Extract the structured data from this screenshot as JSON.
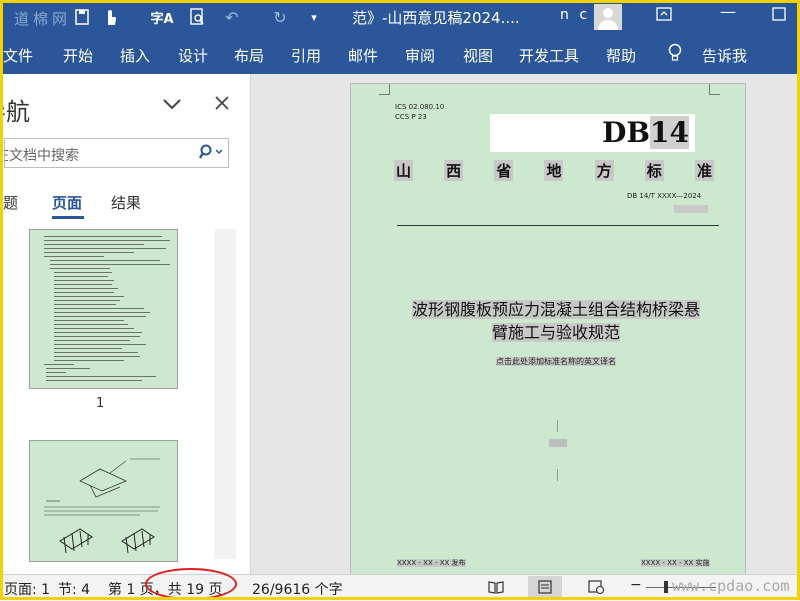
{
  "titlebar": {
    "title": "范》-山西意见稿2024....",
    "user": "n c",
    "icons": [
      "save-icon",
      "touch-mode-icon",
      "spelling-icon",
      "print-preview-icon",
      "undo-icon",
      "redo-icon",
      "customize-icon"
    ]
  },
  "watermark_top": "道棉网",
  "ribbon": {
    "tabs": [
      "文件",
      "开始",
      "插入",
      "设计",
      "布局",
      "引用",
      "邮件",
      "审阅",
      "视图",
      "开发工具",
      "帮助"
    ],
    "tell_me": "告诉我"
  },
  "nav": {
    "title": "导航",
    "search_placeholder": "在文档中搜索",
    "tabs": [
      "标题",
      "页面",
      "结果"
    ],
    "active_tab": "页面",
    "thumb_page_number": "1"
  },
  "document": {
    "ics": "ICS  02.080.10",
    "ccs": "CCS  P 23",
    "db_prefix": "DB",
    "db_number": "14",
    "province": [
      "山",
      "西",
      "省",
      "地",
      "方",
      "标",
      "准"
    ],
    "standard_no": "DB 14/T XXXX—2024",
    "title_line1": "波形钢腹板预应力混凝土组合结构桥梁悬",
    "title_line2": "臂施工与验收规范",
    "english_placeholder": "点击此处添加标准名称的英文译名",
    "issue_date": "XXXX - XX - XX 发布",
    "implement_date": "XXXX - XX - XX 实施"
  },
  "status": {
    "page": "页面: 1",
    "section": "节: 4",
    "page_of": "第 1 页，共 19 页",
    "words": "26/9616 个字"
  },
  "watermark_bottom": "www.cpdao.com",
  "colors": {
    "ribbon": "#2b579a",
    "page_bg": "#cce9cf",
    "frame": "#f2d200",
    "annotation_circle": "#e02020"
  }
}
